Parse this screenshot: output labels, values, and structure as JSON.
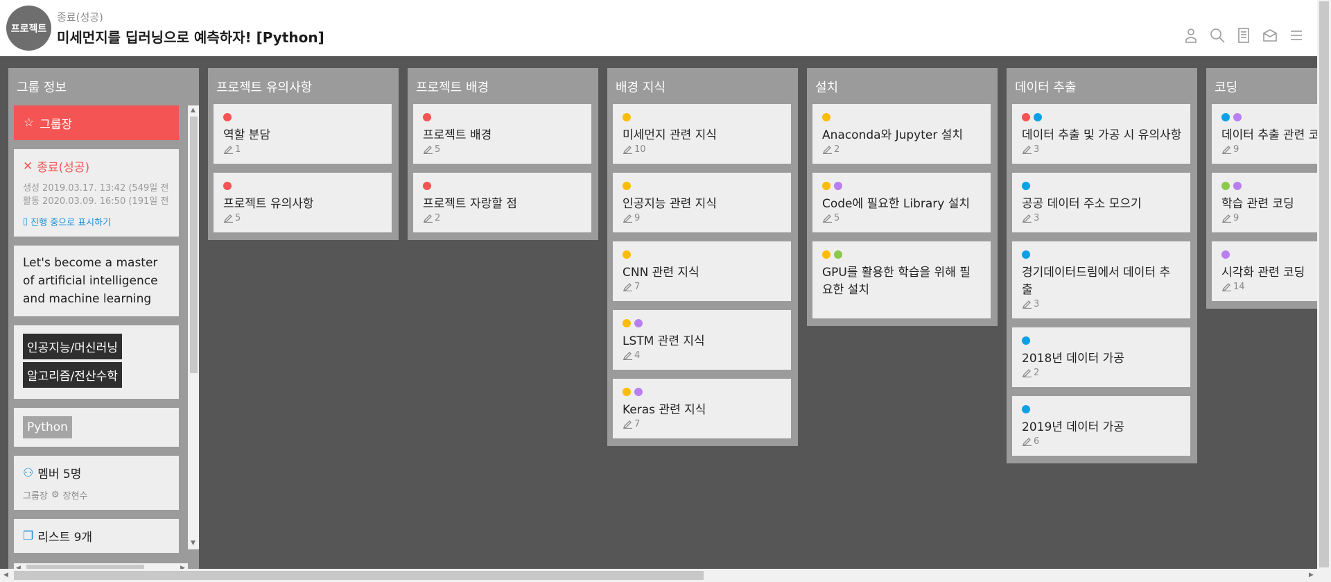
{
  "header": {
    "logo_text": "프로젝트",
    "status": "종료(성공)",
    "title": "미세먼지를 딥러닝으로 예측하자! [Python]",
    "icons": [
      "user-icon",
      "search-icon",
      "document-icon",
      "inbox-icon",
      "menu-icon"
    ]
  },
  "group": {
    "title": "그룹 정보",
    "leader_label": "그룹장",
    "status_label": "종료(성공)",
    "created": "생성 2019.03.17. 13:42 (549일 전",
    "activity": "활동 2020.03.09. 16:50 (191일 전",
    "show_in_progress": "진행 중으로 표시하기",
    "description": "Let's become a master of artificial intelligence and machine learning",
    "tags": [
      "인공지능/머신러닝",
      "알고리즘/전산수학"
    ],
    "language": "Python",
    "members": "멤버 5명",
    "leader_role": "그룹장",
    "leader_name": "장현수",
    "lists_count": "리스트 9개"
  },
  "colors": {
    "red": "#f45454",
    "yellow": "#fbbc05",
    "purple": "#b97ff0",
    "blue": "#0ea0e6",
    "green": "#8cc84b"
  },
  "lists": [
    {
      "title": "프로젝트 유의사항",
      "cards": [
        {
          "title": "역할 분담",
          "count": "1",
          "dots": [
            "#f45454"
          ]
        },
        {
          "title": "프로젝트 유의사항",
          "count": "5",
          "dots": [
            "#f45454"
          ]
        }
      ]
    },
    {
      "title": "프로젝트 배경",
      "cards": [
        {
          "title": "프로젝트 배경",
          "count": "5",
          "dots": [
            "#f45454"
          ]
        },
        {
          "title": "프로젝트 자랑할 점",
          "count": "2",
          "dots": [
            "#f45454"
          ]
        }
      ]
    },
    {
      "title": "배경 지식",
      "cards": [
        {
          "title": "미세먼지 관련 지식",
          "count": "10",
          "dots": [
            "#fbbc05"
          ]
        },
        {
          "title": "인공지능 관련 지식",
          "count": "9",
          "dots": [
            "#fbbc05"
          ]
        },
        {
          "title": "CNN 관련 지식",
          "count": "7",
          "dots": [
            "#fbbc05"
          ]
        },
        {
          "title": "LSTM 관련 지식",
          "count": "4",
          "dots": [
            "#fbbc05",
            "#b97ff0"
          ]
        },
        {
          "title": "Keras 관련 지식",
          "count": "7",
          "dots": [
            "#fbbc05",
            "#b97ff0"
          ]
        }
      ]
    },
    {
      "title": "설치",
      "cards": [
        {
          "title": "Anaconda와 Jupyter 설치",
          "count": "2",
          "dots": [
            "#fbbc05"
          ]
        },
        {
          "title": "Code에 필요한 Library 설치",
          "count": "5",
          "dots": [
            "#fbbc05",
            "#b97ff0"
          ]
        },
        {
          "title": "GPU를 활용한 학습을 위해 필요한 설치",
          "count": "",
          "dots": [
            "#fbbc05",
            "#8cc84b"
          ],
          "tall": true
        }
      ]
    },
    {
      "title": "데이터 추출",
      "cards": [
        {
          "title": "데이터 추출 및 가공 시 유의사항",
          "count": "3",
          "dots": [
            "#f45454",
            "#0ea0e6"
          ]
        },
        {
          "title": "공공 데이터 주소 모으기",
          "count": "3",
          "dots": [
            "#0ea0e6"
          ]
        },
        {
          "title": "경기데이터드림에서 데이터 추출",
          "count": "3",
          "dots": [
            "#0ea0e6"
          ],
          "tall": true
        },
        {
          "title": "2018년 데이터 가공",
          "count": "2",
          "dots": [
            "#0ea0e6"
          ]
        },
        {
          "title": "2019년 데이터 가공",
          "count": "6",
          "dots": [
            "#0ea0e6"
          ]
        }
      ]
    },
    {
      "title": "코딩",
      "cards": [
        {
          "title": "데이터 추출 관련 코딩",
          "count": "9",
          "dots": [
            "#0ea0e6",
            "#b97ff0"
          ]
        },
        {
          "title": "학습 관련 코딩",
          "count": "9",
          "dots": [
            "#8cc84b",
            "#b97ff0"
          ]
        },
        {
          "title": "시각화 관련 코딩",
          "count": "14",
          "dots": [
            "#b97ff0"
          ]
        }
      ]
    }
  ]
}
